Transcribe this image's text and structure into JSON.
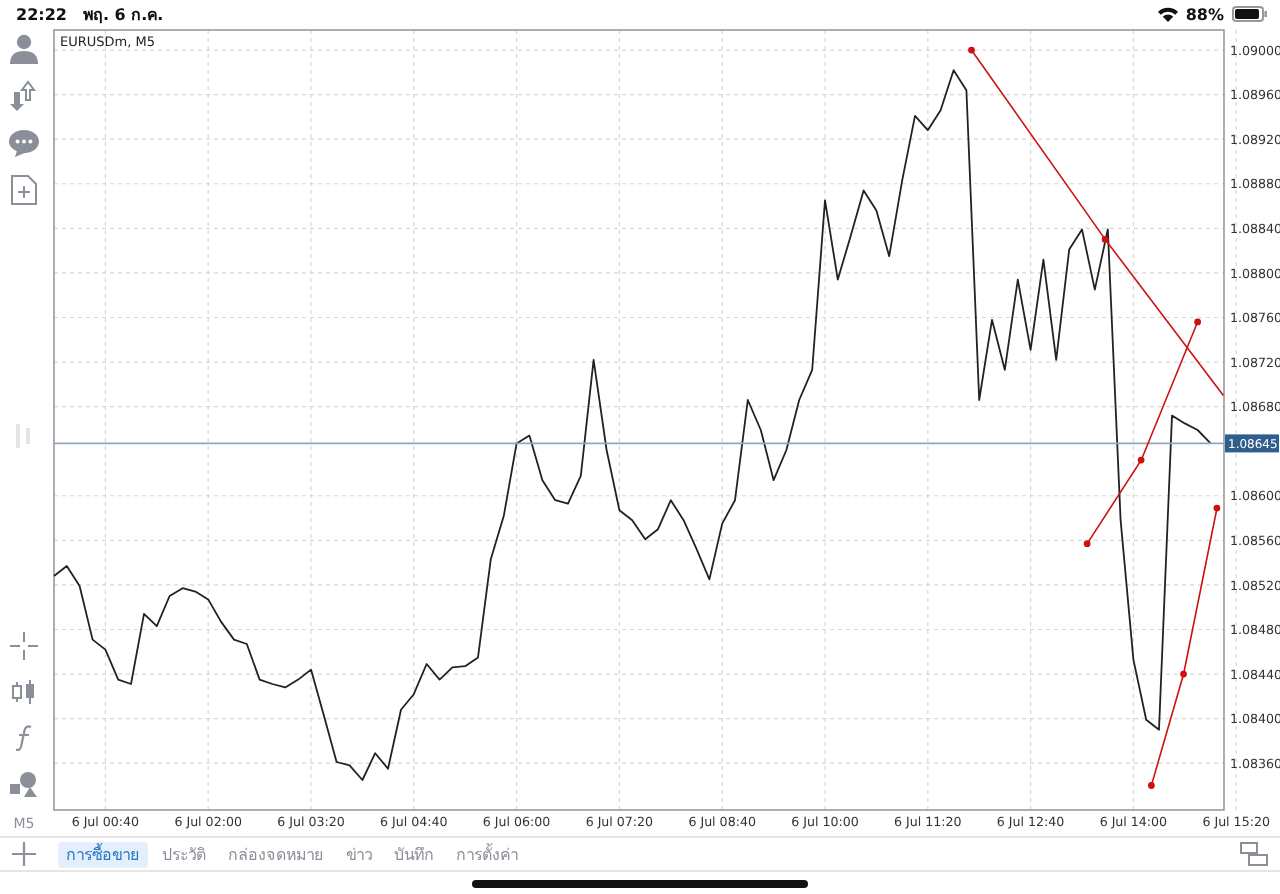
{
  "status_bar": {
    "time": "22:22",
    "date": "พฤ. 6 ก.ค.",
    "battery": "88%"
  },
  "toolbar": {
    "timeframe": "M5"
  },
  "chart": {
    "chart_data": {
      "type": "line",
      "title": "EURUSDm, M5",
      "categories": [
        null,
        null,
        null,
        null,
        "6 Jul 00:40",
        null,
        null,
        null,
        null,
        null,
        null,
        null,
        "6 Jul 02:00",
        null,
        null,
        null,
        null,
        null,
        null,
        null,
        "6 Jul 03:20",
        null,
        null,
        null,
        null,
        null,
        null,
        null,
        "6 Jul 04:40",
        null,
        null,
        null,
        null,
        null,
        null,
        null,
        "6 Jul 06:00",
        null,
        null,
        null,
        null,
        null,
        null,
        null,
        "6 Jul 07:20",
        null,
        null,
        null,
        null,
        null,
        null,
        null,
        "6 Jul 08:40",
        null,
        null,
        null,
        null,
        null,
        null,
        null,
        "6 Jul 10:00",
        null,
        null,
        null,
        null,
        null,
        null,
        null,
        "6 Jul 11:20",
        null,
        null,
        null,
        null,
        null,
        null,
        null,
        "6 Jul 12:40",
        null,
        null,
        null,
        null,
        null,
        null,
        null,
        "6 Jul 14:00",
        null,
        null,
        null,
        null,
        null,
        null,
        null,
        "6 Jul 15:20"
      ],
      "series": [
        {
          "color": "#222222",
          "values": [
            1.08528,
            1.08537,
            1.08519,
            1.08471,
            1.08462,
            1.08435,
            1.08431,
            1.08494,
            1.08483,
            1.0851,
            1.08517,
            1.08514,
            1.08507,
            1.08487,
            1.08471,
            1.08467,
            1.08435,
            1.08431,
            1.08428,
            1.08435,
            1.08444,
            1.08403,
            1.08361,
            1.08358,
            1.08345,
            1.08369,
            1.08355,
            1.08408,
            1.08422,
            1.08449,
            1.08435,
            1.08446,
            1.08447,
            1.08455,
            1.08543,
            1.08582,
            1.08647,
            1.08654,
            1.08614,
            1.08596,
            1.08593,
            1.08618,
            1.08722,
            1.08641,
            1.08587,
            1.08578,
            1.08561,
            1.0857,
            1.08596,
            1.08578,
            1.08552,
            1.08525,
            1.08575,
            1.08596,
            1.08686,
            1.08659,
            1.08614,
            1.08641,
            1.08686,
            1.08713,
            1.08865,
            1.08794,
            1.08833,
            1.08874,
            1.08856,
            1.08815,
            1.08883,
            1.08941,
            1.08928,
            1.08946,
            1.08982,
            1.08964,
            1.08686,
            1.08758,
            1.08713,
            1.08794,
            1.08731,
            1.08812,
            1.08722,
            1.08821,
            1.08839,
            1.08785,
            1.08839,
            1.08578,
            1.08453,
            1.08399,
            1.0839,
            1.08672,
            1.08665,
            1.08659,
            1.08647,
            null,
            null
          ]
        }
      ],
      "ylim": [
        1.08318,
        1.09018
      ],
      "yticks": [
        {
          "value": 1.09,
          "label": "1.09000"
        },
        {
          "value": 1.0896,
          "label": "1.08960"
        },
        {
          "value": 1.0892,
          "label": "1.08920"
        },
        {
          "value": 1.0888,
          "label": "1.08880"
        },
        {
          "value": 1.0884,
          "label": "1.08840"
        },
        {
          "value": 1.088,
          "label": "1.08800"
        },
        {
          "value": 1.0876,
          "label": "1.08760"
        },
        {
          "value": 1.0872,
          "label": "1.08720"
        },
        {
          "value": 1.0868,
          "label": "1.08680"
        },
        {
          "value": 1.086,
          "label": "1.08600"
        },
        {
          "value": 1.0856,
          "label": "1.08560"
        },
        {
          "value": 1.0852,
          "label": "1.08520"
        },
        {
          "value": 1.0848,
          "label": "1.08480"
        },
        {
          "value": 1.0844,
          "label": "1.08440"
        },
        {
          "value": 1.084,
          "label": "1.08400"
        },
        {
          "value": 1.0836,
          "label": "1.08360"
        }
      ],
      "grid": true
    },
    "current_price": "1.08645"
  },
  "tabs": [
    {
      "label": "การซื้อขาย",
      "selected": true
    },
    {
      "label": "ประวัติ",
      "selected": false
    },
    {
      "label": "กล่องจดหมาย",
      "selected": false
    },
    {
      "label": "ข่าว",
      "selected": false
    },
    {
      "label": "บันทึก",
      "selected": false
    },
    {
      "label": "การตั้งค่า",
      "selected": false
    }
  ]
}
